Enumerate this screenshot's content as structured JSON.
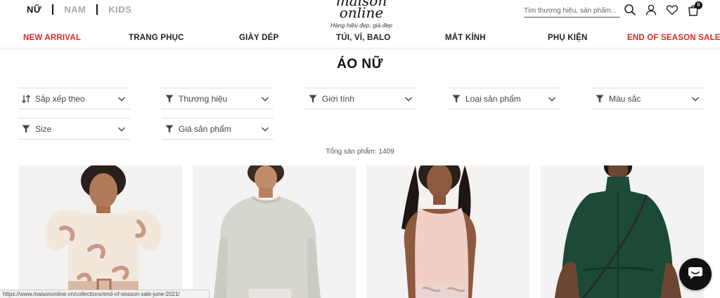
{
  "gender_tabs": [
    "NỮ",
    "NAM",
    "KIDS"
  ],
  "logo": {
    "line1": "maison",
    "line2": "online",
    "tagline": "Hàng hiệu đẹp, giá đẹp"
  },
  "search": {
    "placeholder": "Tìm thương hiệu, sản phẩm..."
  },
  "cart_count": "0",
  "nav": [
    {
      "label": "NEW ARRIVAL",
      "highlight": true
    },
    {
      "label": "TRANG PHỤC",
      "highlight": false
    },
    {
      "label": "GIÀY DÉP",
      "highlight": false
    },
    {
      "label": "TÚI, VÍ, BALO",
      "highlight": false
    },
    {
      "label": "MẮT KÍNH",
      "highlight": false
    },
    {
      "label": "PHỤ KIỆN",
      "highlight": false
    },
    {
      "label": "END OF SEASON SALE",
      "highlight": true
    }
  ],
  "page_title": "ÁO NỮ",
  "filters": [
    {
      "label": "Sắp xếp theo",
      "icon": "sort-icon"
    },
    {
      "label": "Thương hiệu",
      "icon": "filter-icon"
    },
    {
      "label": "Giới tính",
      "icon": "filter-icon"
    },
    {
      "label": "Loại sản phẩm",
      "icon": "filter-icon"
    },
    {
      "label": "Màu sắc",
      "icon": "filter-icon"
    },
    {
      "label": "Size",
      "icon": "filter-icon"
    },
    {
      "label": "Giá sản phẩm",
      "icon": "filter-icon"
    }
  ],
  "total_label": "Tổng sản phẩm: 1409",
  "status_url": "https://www.maisononline.vn/collections/end-of-season-sale-june-2021/",
  "colors": {
    "accent_red": "#e32627",
    "text": "#222222"
  }
}
